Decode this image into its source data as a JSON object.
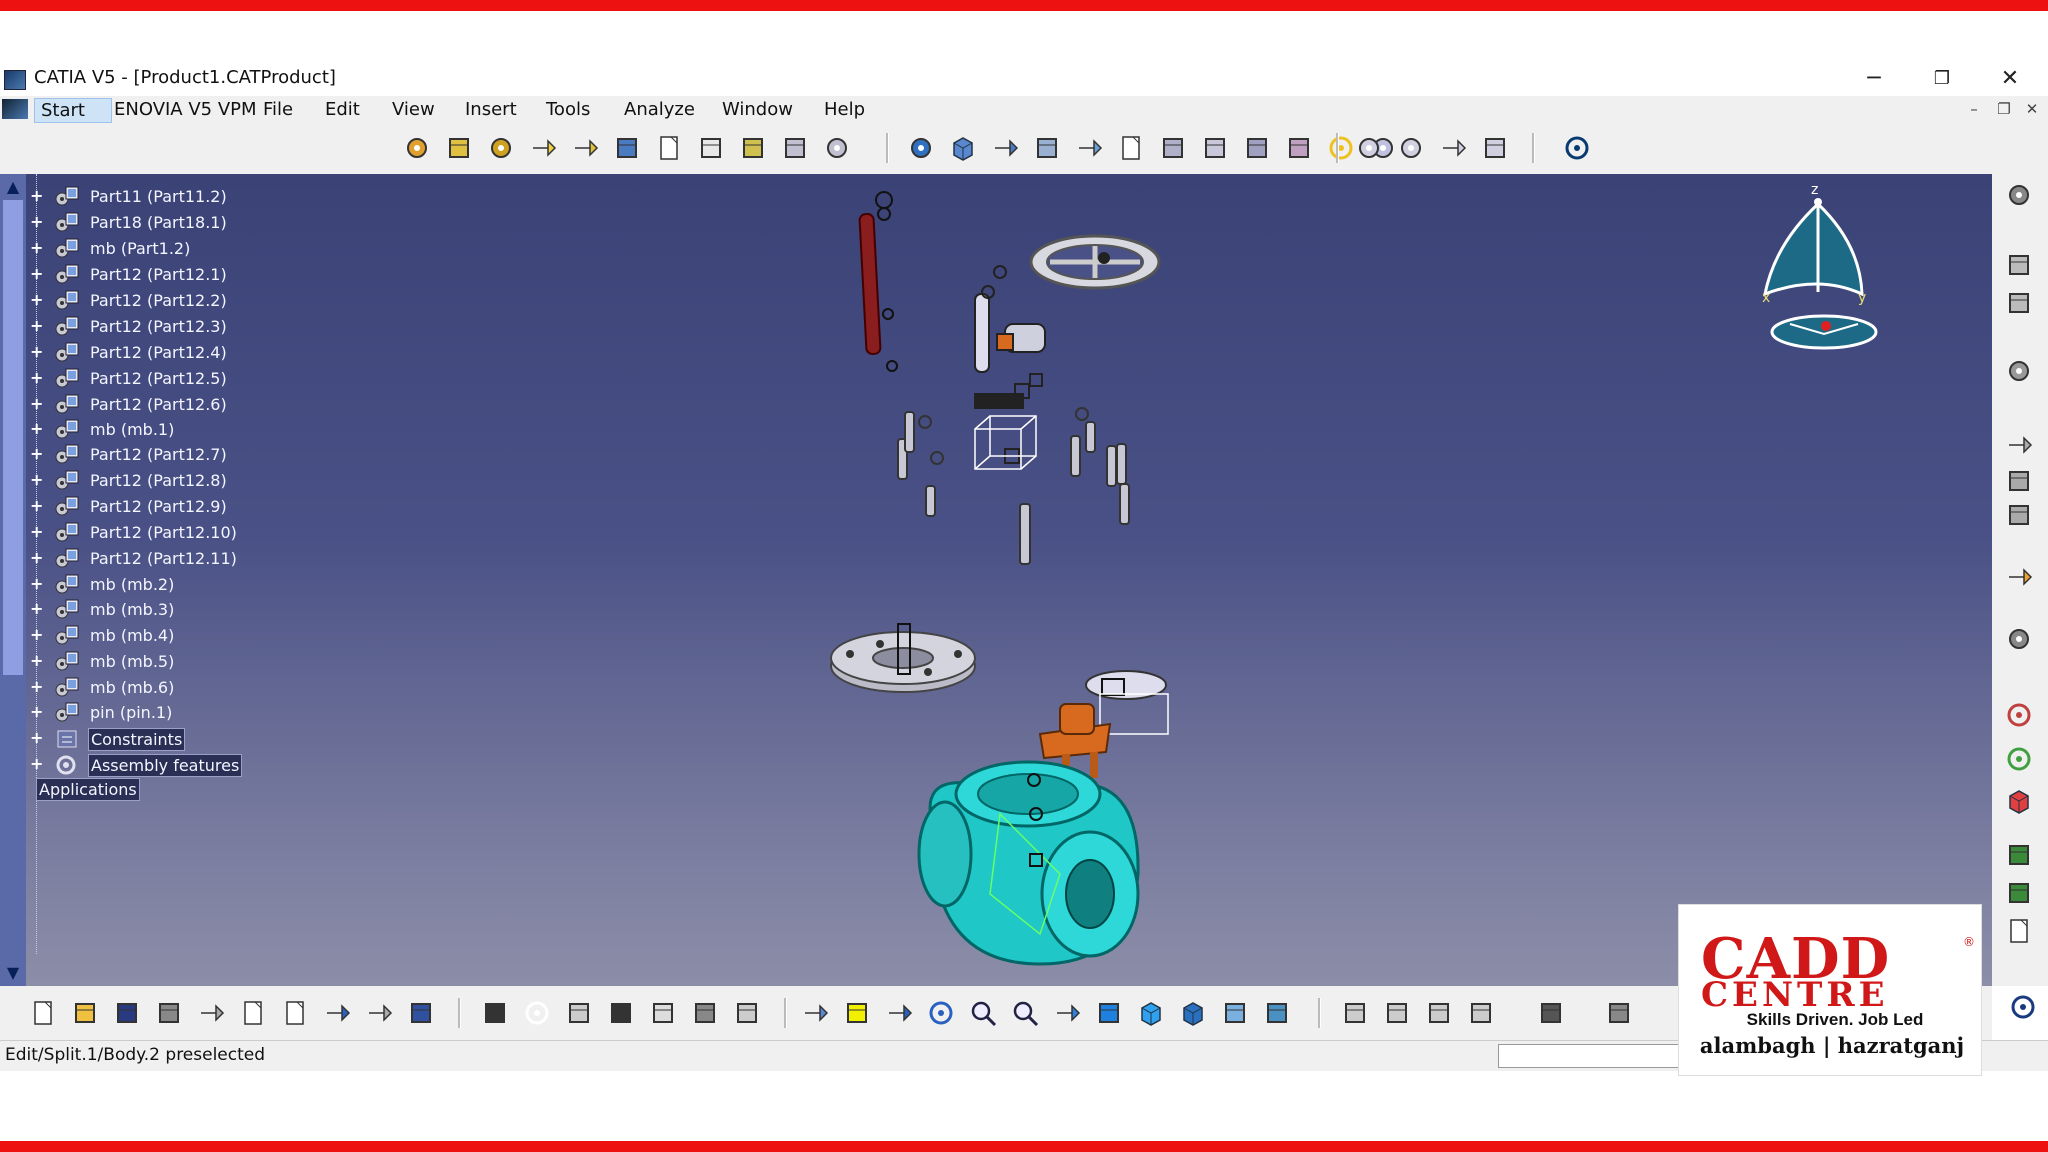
{
  "window": {
    "title": "CATIA V5 - [Product1.CATProduct]",
    "controls": {
      "minimize": "─",
      "restore": "❐",
      "close": "✕"
    }
  },
  "menu": {
    "items": [
      "Start",
      "ENOVIA V5 VPM",
      "File",
      "Edit",
      "View",
      "Insert",
      "Tools",
      "Analyze",
      "Window",
      "Help"
    ],
    "mdi": {
      "minimize": "–",
      "restore": "❐",
      "close": "✕"
    }
  },
  "tree": {
    "items": [
      {
        "label": "Part11 (Part11.2)",
        "icon": "part-icon"
      },
      {
        "label": "Part18 (Part18.1)",
        "icon": "part-icon"
      },
      {
        "label": "mb (Part1.2)",
        "icon": "part-icon"
      },
      {
        "label": "Part12 (Part12.1)",
        "icon": "part-icon"
      },
      {
        "label": "Part12 (Part12.2)",
        "icon": "part-icon"
      },
      {
        "label": "Part12 (Part12.3)",
        "icon": "part-icon"
      },
      {
        "label": "Part12 (Part12.4)",
        "icon": "part-icon"
      },
      {
        "label": "Part12 (Part12.5)",
        "icon": "part-icon"
      },
      {
        "label": "Part12 (Part12.6)",
        "icon": "part-icon"
      },
      {
        "label": "mb (mb.1)",
        "icon": "part-icon"
      },
      {
        "label": "Part12 (Part12.7)",
        "icon": "part-icon"
      },
      {
        "label": "Part12 (Part12.8)",
        "icon": "part-icon"
      },
      {
        "label": "Part12 (Part12.9)",
        "icon": "part-icon"
      },
      {
        "label": "Part12 (Part12.10)",
        "icon": "part-icon"
      },
      {
        "label": "Part12 (Part12.11)",
        "icon": "part-icon"
      },
      {
        "label": "mb (mb.2)",
        "icon": "part-icon"
      },
      {
        "label": "mb (mb.3)",
        "icon": "part-icon"
      },
      {
        "label": "mb (mb.4)",
        "icon": "part-icon"
      },
      {
        "label": "mb (mb.5)",
        "icon": "part-icon"
      },
      {
        "label": "mb (mb.6)",
        "icon": "part-icon"
      },
      {
        "label": "pin (pin.1)",
        "icon": "part-icon"
      },
      {
        "label": "Constraints",
        "icon": "constraints-icon"
      },
      {
        "label": "Assembly features",
        "icon": "assembly-features-icon"
      },
      {
        "label": "Applications",
        "icon": "none"
      }
    ]
  },
  "compass": {
    "x_label": "x",
    "y_label": "y",
    "z_label": "z"
  },
  "status": {
    "message": "Edit/Split.1/Body.2 preselected"
  },
  "logo": {
    "line1": "CADD",
    "line2": "CENTRE",
    "registered": "®",
    "tagline": "Skills Driven. Job Led",
    "locations": "alambagh | hazratganj"
  },
  "colors": {
    "accent_red": "#ee1111",
    "viewport_top": "#3a4276",
    "viewport_bottom": "#8c8ea8",
    "valve_body": "#1fc7c7",
    "bonnet": "#d86a20",
    "stem": "#8a1d1d"
  }
}
